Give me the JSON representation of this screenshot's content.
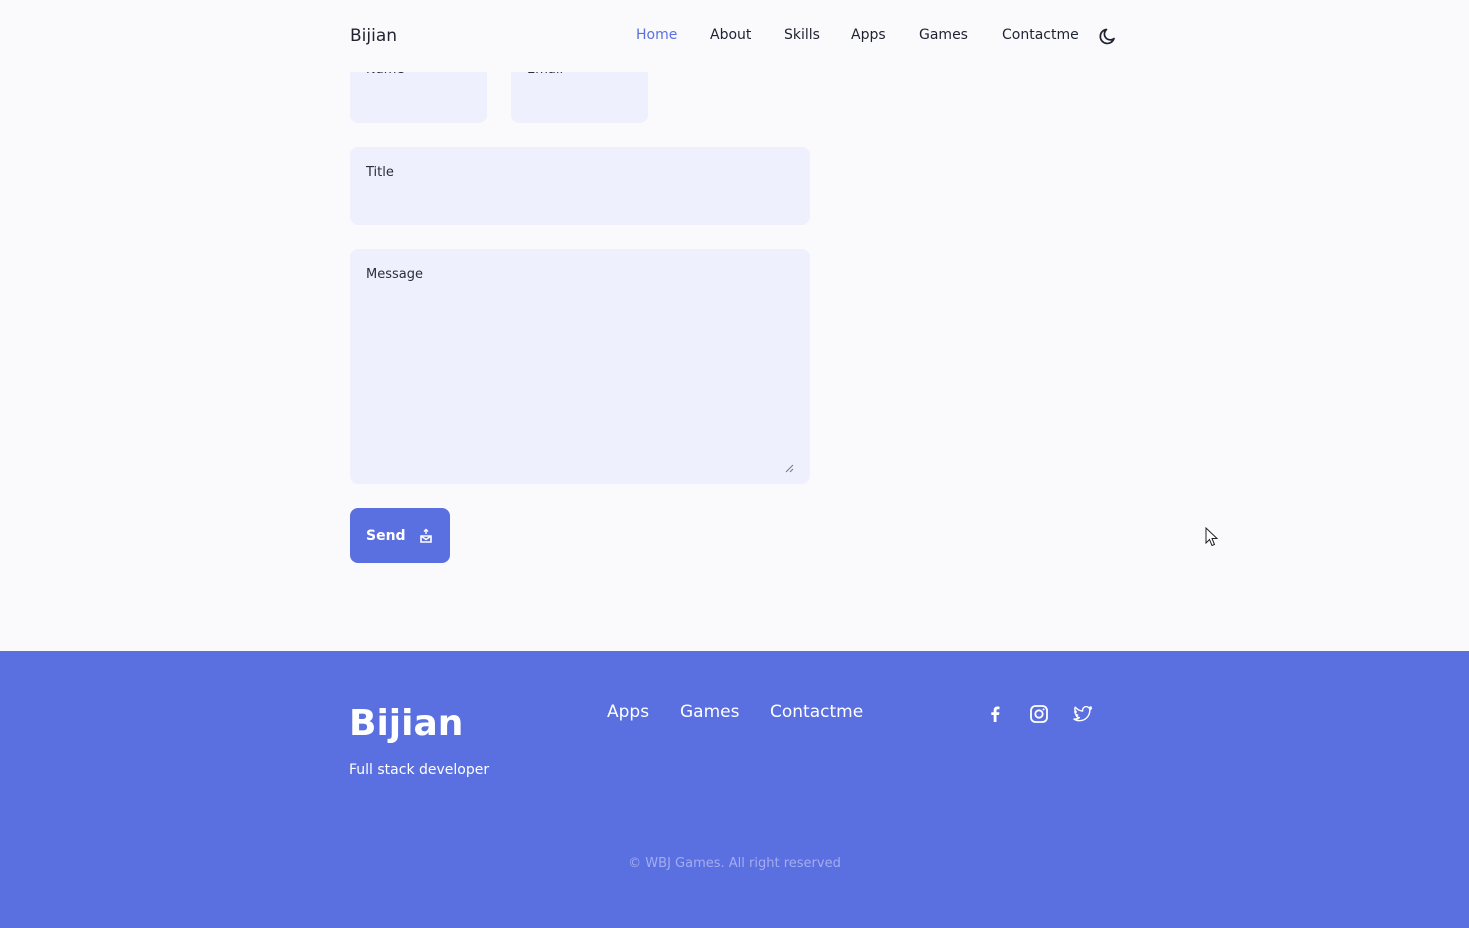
{
  "header": {
    "logo": "Bijian",
    "nav": [
      {
        "label": "Home",
        "active": true
      },
      {
        "label": "About",
        "active": false
      },
      {
        "label": "Skills",
        "active": false
      },
      {
        "label": "Apps",
        "active": false
      },
      {
        "label": "Games",
        "active": false
      },
      {
        "label": "Contactme",
        "active": false
      }
    ],
    "theme_toggle_icon": "moon-icon"
  },
  "form": {
    "name_label": "Name",
    "email_label": "Email",
    "title_label": "Title",
    "message_label": "Message",
    "send_label": "Send",
    "send_icon": "send-icon"
  },
  "footer": {
    "brand": "Bijian",
    "tagline": "Full stack developer",
    "links": [
      "Apps",
      "Games",
      "Contactme"
    ],
    "social_icons": [
      "facebook-icon",
      "instagram-icon",
      "twitter-icon"
    ],
    "copyright": "© WBJ Games. All right reserved"
  },
  "colors": {
    "accent": "#5a6fe0",
    "background": "#fafafd",
    "input_background": "#eff0fd",
    "text": "#1f2230",
    "copyright_text": "#a3adf0"
  }
}
